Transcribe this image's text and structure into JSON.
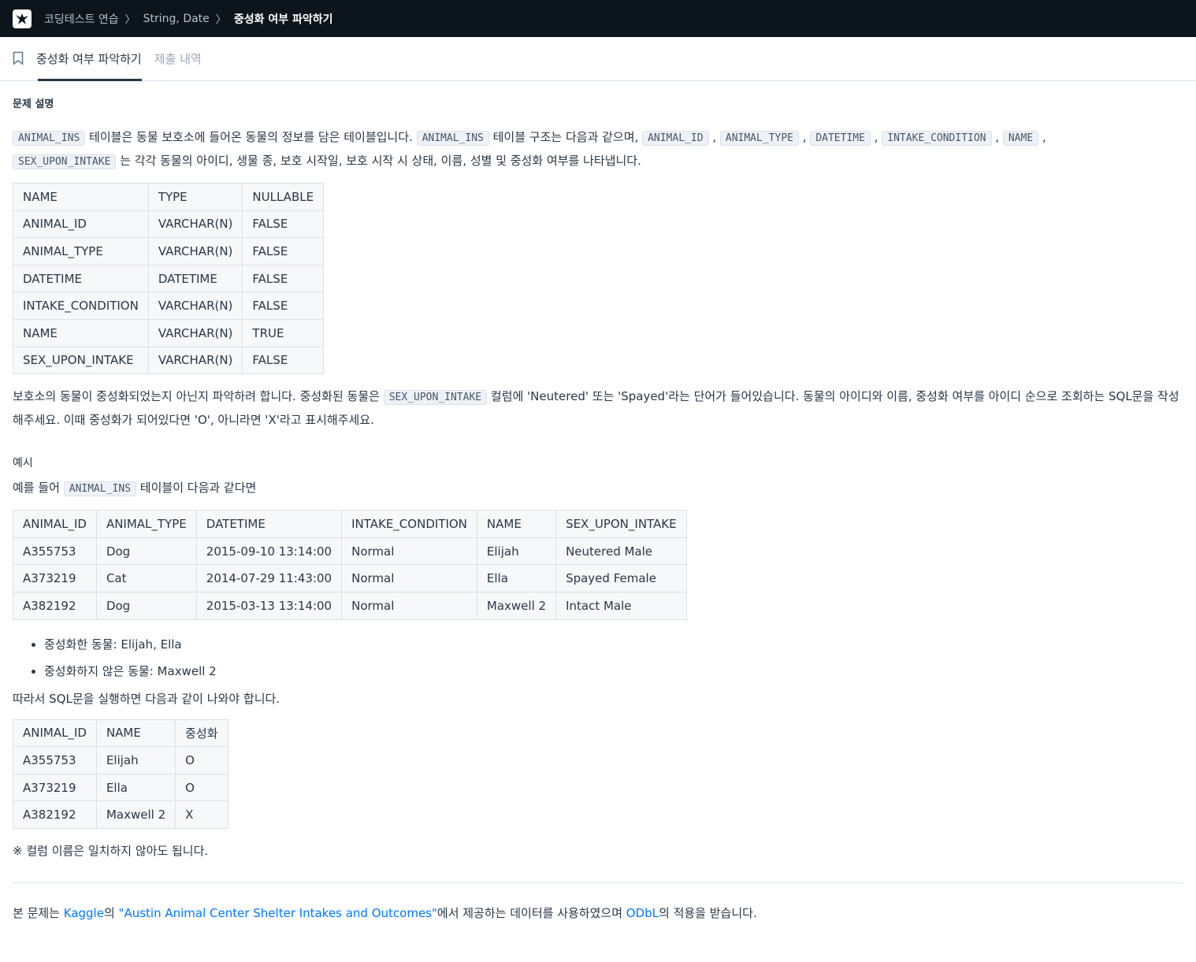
{
  "breadcrumb": {
    "items": [
      "코딩테스트 연습",
      "String, Date",
      "중성화 여부 파악하기"
    ]
  },
  "tabs": [
    {
      "label": "중성화 여부 파악하기"
    },
    {
      "label": "제출 내역"
    }
  ],
  "section_title": "문제 설명",
  "intro": {
    "code1": "ANIMAL_INS",
    "t1": " 테이블은 동물 보호소에 들어온 동물의 정보를 담은 테이블입니다. ",
    "code2": "ANIMAL_INS",
    "t2": " 테이블 구조는 다음과 같으며, ",
    "cols": [
      "ANIMAL_ID",
      "ANIMAL_TYPE",
      "DATETIME",
      "INTAKE_CONDITION",
      "NAME",
      "SEX_UPON_INTAKE"
    ],
    "sep": ",",
    "t3": "는 각각 동물의 아이디, 생물 종, 보호 시작일, 보호 시작 시 상태, 이름, 성별 및 중성화 여부를 나타냅니다."
  },
  "schema_table": {
    "headers": [
      "NAME",
      "TYPE",
      "NULLABLE"
    ],
    "rows": [
      [
        "ANIMAL_ID",
        "VARCHAR(N)",
        "FALSE"
      ],
      [
        "ANIMAL_TYPE",
        "VARCHAR(N)",
        "FALSE"
      ],
      [
        "DATETIME",
        "DATETIME",
        "FALSE"
      ],
      [
        "INTAKE_CONDITION",
        "VARCHAR(N)",
        "FALSE"
      ],
      [
        "NAME",
        "VARCHAR(N)",
        "TRUE"
      ],
      [
        "SEX_UPON_INTAKE",
        "VARCHAR(N)",
        "FALSE"
      ]
    ]
  },
  "task": {
    "t1": "보호소의 동물이 중성화되었는지 아닌지 파악하려 합니다. 중성화된 동물은 ",
    "code": "SEX_UPON_INTAKE",
    "t2": " 컬럼에 'Neutered' 또는 'Spayed'라는 단어가 들어있습니다. 동물의 아이디와 이름, 중성화 여부를 아이디 순으로 조회하는 SQL문을 작성해주세요. 이때 중성화가 되어있다면 'O', 아니라면 'X'라고 표시해주세요."
  },
  "example_label": "예시",
  "example_intro": {
    "t1": "예를 들어 ",
    "code": "ANIMAL_INS",
    "t2": " 테이블이 다음과 같다면"
  },
  "example_table": {
    "headers": [
      "ANIMAL_ID",
      "ANIMAL_TYPE",
      "DATETIME",
      "INTAKE_CONDITION",
      "NAME",
      "SEX_UPON_INTAKE"
    ],
    "rows": [
      [
        "A355753",
        "Dog",
        "2015-09-10 13:14:00",
        "Normal",
        "Elijah",
        "Neutered Male"
      ],
      [
        "A373219",
        "Cat",
        "2014-07-29 11:43:00",
        "Normal",
        "Ella",
        "Spayed Female"
      ],
      [
        "A382192",
        "Dog",
        "2015-03-13 13:14:00",
        "Normal",
        "Maxwell 2",
        "Intact Male"
      ]
    ]
  },
  "bullets": [
    "중성화한 동물: Elijah, Ella",
    "중성화하지 않은 동물: Maxwell 2"
  ],
  "result_intro": "따라서 SQL문을 실행하면 다음과 같이 나와야 합니다.",
  "result_table": {
    "headers": [
      "ANIMAL_ID",
      "NAME",
      "중성화"
    ],
    "rows": [
      [
        "A355753",
        "Elijah",
        "O"
      ],
      [
        "A373219",
        "Ella",
        "O"
      ],
      [
        "A382192",
        "Maxwell 2",
        "X"
      ]
    ]
  },
  "note": "※ 컬럼 이름은 일치하지 않아도 됩니다.",
  "footer": {
    "t1": "본 문제는 ",
    "link1": "Kaggle",
    "t2": "의 ",
    "link2": "\"Austin Animal Center Shelter Intakes and Outcomes\"",
    "t3": "에서 제공하는 데이터를 사용하였으며 ",
    "link3": "ODbL",
    "t4": "의 적용을 받습니다."
  },
  "colors": {
    "topbar": "#0c151c",
    "link": "#0078ff",
    "text": "#263747"
  }
}
